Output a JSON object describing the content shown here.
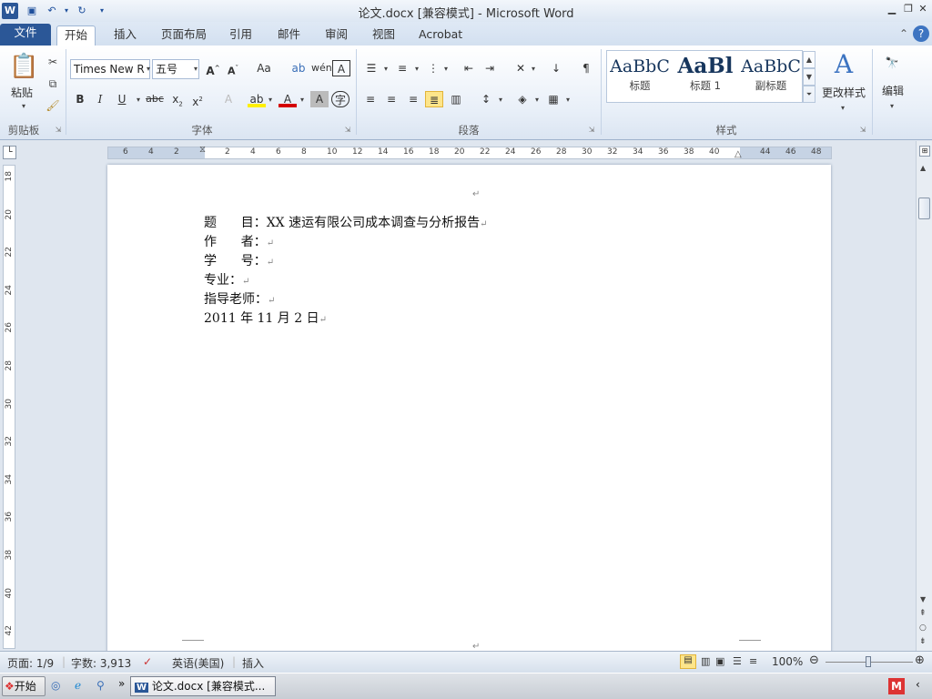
{
  "window": {
    "title": "论文.docx [兼容模式] - Microsoft Word"
  },
  "quick_access": {
    "word_icon": "W",
    "save_icon": "save-icon",
    "undo_icon": "undo-icon",
    "redo_icon": "redo-icon"
  },
  "tabs": [
    {
      "label": "文件"
    },
    {
      "label": "开始"
    },
    {
      "label": "插入"
    },
    {
      "label": "页面布局"
    },
    {
      "label": "引用"
    },
    {
      "label": "邮件"
    },
    {
      "label": "审阅"
    },
    {
      "label": "视图"
    },
    {
      "label": "Acrobat"
    }
  ],
  "ribbon": {
    "clipboard": {
      "paste_label": "粘贴",
      "group_label": "剪贴板"
    },
    "font": {
      "font_name": "Times New R",
      "font_size": "五号",
      "group_label": "字体"
    },
    "paragraph": {
      "group_label": "段落"
    },
    "styles": {
      "group_label": "样式",
      "items": [
        {
          "preview": "AaBbC",
          "label": "标题"
        },
        {
          "preview": "AaBl",
          "label": "标题 1"
        },
        {
          "preview": "AaBbC",
          "label": "副标题"
        }
      ],
      "change_styles": "更改样式"
    },
    "editing": {
      "label": "编辑"
    }
  },
  "ruler": {
    "h_ticks": [
      "6",
      "4",
      "2",
      "2",
      "4",
      "6",
      "8",
      "10",
      "12",
      "14",
      "16",
      "18",
      "20",
      "22",
      "24",
      "26",
      "28",
      "30",
      "32",
      "34",
      "36",
      "38",
      "40",
      "44",
      "46",
      "48"
    ],
    "v_ticks": [
      "18",
      "20",
      "22",
      "24",
      "26",
      "28",
      "30",
      "32",
      "34",
      "36",
      "38",
      "40",
      "42"
    ]
  },
  "document": {
    "lines": [
      {
        "label": "题",
        "label2": "目：",
        "value": "XX 速运有限公司成本调查与分析报告"
      },
      {
        "label": "作",
        "label2": "者：",
        "value": ""
      },
      {
        "label": "学",
        "label2": "号：",
        "value": ""
      },
      {
        "label": "专业：",
        "label2": "",
        "value": ""
      },
      {
        "label": "指导老师：",
        "label2": "",
        "value": ""
      },
      {
        "label": "2011 年 11 月 2 日",
        "label2": "",
        "value": ""
      }
    ],
    "para_mark": "↵"
  },
  "status": {
    "page": "页面: 1/9",
    "words": "字数: 3,913",
    "language": "英语(美国)",
    "mode": "插入",
    "zoom": "100%"
  },
  "taskbar": {
    "start": "开始",
    "task": "论文.docx [兼容模式..."
  }
}
